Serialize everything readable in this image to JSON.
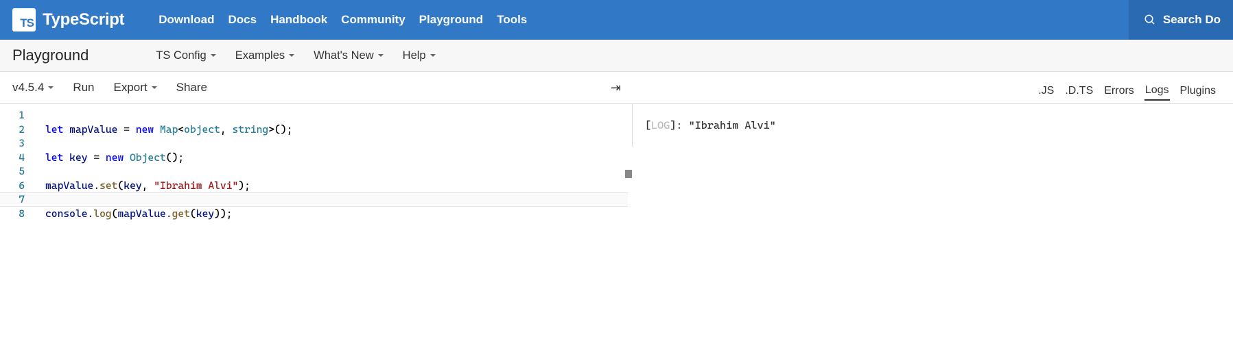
{
  "header": {
    "logo_short": "TS",
    "logo_text": "TypeScript",
    "nav": [
      "Download",
      "Docs",
      "Handbook",
      "Community",
      "Playground",
      "Tools"
    ],
    "search_label": "Search Do"
  },
  "subnav": {
    "title": "Playground",
    "items": [
      "TS Config",
      "Examples",
      "What's New",
      "Help"
    ]
  },
  "toolbar": {
    "version": "v4.5.4",
    "run": "Run",
    "export": "Export",
    "share": "Share",
    "arrow": "⇥"
  },
  "editor": {
    "lines": [
      {
        "num": 1,
        "tokens": []
      },
      {
        "num": 2,
        "tokens": [
          {
            "t": "let ",
            "c": "tk-kw"
          },
          {
            "t": "mapValue",
            "c": "tk-var"
          },
          {
            "t": " = ",
            "c": "tk-plain"
          },
          {
            "t": "new ",
            "c": "tk-kw"
          },
          {
            "t": "Map",
            "c": "tk-type"
          },
          {
            "t": "<",
            "c": "tk-punc"
          },
          {
            "t": "object",
            "c": "tk-type"
          },
          {
            "t": ", ",
            "c": "tk-punc"
          },
          {
            "t": "string",
            "c": "tk-type"
          },
          {
            "t": ">();",
            "c": "tk-punc"
          }
        ]
      },
      {
        "num": 3,
        "tokens": []
      },
      {
        "num": 4,
        "tokens": [
          {
            "t": "let ",
            "c": "tk-kw"
          },
          {
            "t": "key",
            "c": "tk-var"
          },
          {
            "t": " = ",
            "c": "tk-plain"
          },
          {
            "t": "new ",
            "c": "tk-kw"
          },
          {
            "t": "Object",
            "c": "tk-type"
          },
          {
            "t": "();",
            "c": "tk-punc"
          }
        ]
      },
      {
        "num": 5,
        "tokens": []
      },
      {
        "num": 6,
        "tokens": [
          {
            "t": "mapValue",
            "c": "tk-var"
          },
          {
            "t": ".",
            "c": "tk-punc"
          },
          {
            "t": "set",
            "c": "tk-fn"
          },
          {
            "t": "(",
            "c": "tk-punc"
          },
          {
            "t": "key",
            "c": "tk-var"
          },
          {
            "t": ", ",
            "c": "tk-punc"
          },
          {
            "t": "\"Ibrahim Alvi\"",
            "c": "tk-str"
          },
          {
            "t": ");",
            "c": "tk-punc"
          }
        ]
      },
      {
        "num": 7,
        "tokens": []
      },
      {
        "num": 8,
        "tokens": [
          {
            "t": "console",
            "c": "tk-var"
          },
          {
            "t": ".",
            "c": "tk-punc"
          },
          {
            "t": "log",
            "c": "tk-fn"
          },
          {
            "t": "(",
            "c": "tk-punc"
          },
          {
            "t": "mapValue",
            "c": "tk-var"
          },
          {
            "t": ".",
            "c": "tk-punc"
          },
          {
            "t": "get",
            "c": "tk-fn"
          },
          {
            "t": "(",
            "c": "tk-punc"
          },
          {
            "t": "key",
            "c": "tk-var"
          },
          {
            "t": "));",
            "c": "tk-punc"
          }
        ]
      }
    ]
  },
  "output": {
    "tabs": [
      ".JS",
      ".D.TS",
      "Errors",
      "Logs",
      "Plugins"
    ],
    "active_tab": "Logs",
    "log_prefix": "[",
    "log_tag": "LOG",
    "log_suffix": "]:  ",
    "log_value": "\"Ibrahim Alvi\""
  }
}
